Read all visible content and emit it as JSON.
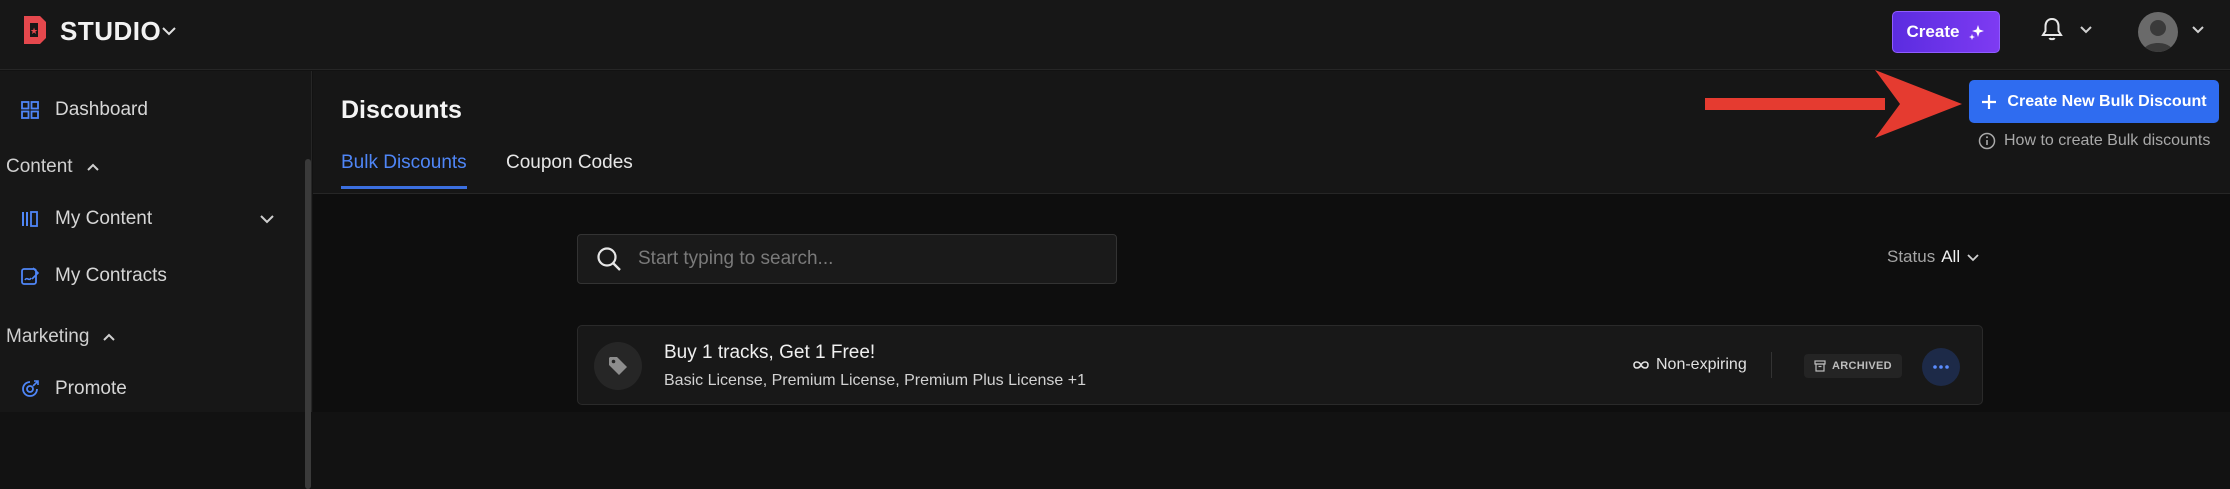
{
  "header": {
    "brand": "STUDIO",
    "create_label": "Create"
  },
  "sidebar": {
    "items": [
      {
        "label": "Dashboard"
      },
      {
        "label": "My Content"
      },
      {
        "label": "My Contracts"
      },
      {
        "label": "Promote"
      }
    ],
    "sections": [
      {
        "label": "Content"
      },
      {
        "label": "Marketing"
      }
    ]
  },
  "page": {
    "title": "Discounts",
    "tabs": [
      {
        "label": "Bulk Discounts",
        "active": true
      },
      {
        "label": "Coupon Codes",
        "active": false
      }
    ],
    "create_bulk_label": "Create New Bulk Discount",
    "howto_label": "How to create Bulk discounts"
  },
  "search": {
    "placeholder": "Start typing to search..."
  },
  "filter": {
    "status_label": "Status",
    "status_value": "All"
  },
  "discounts": [
    {
      "title": "Buy 1 tracks, Get 1 Free!",
      "licenses": "Basic License, Premium License, Premium Plus License +1",
      "expiry": "Non-expiring",
      "badge": "ARCHIVED"
    }
  ],
  "colors": {
    "accent_blue": "#2f6cf0",
    "create_purple": "#6a34ea",
    "logo_red": "#e5484d",
    "annotation_arrow": "#e53b30"
  }
}
